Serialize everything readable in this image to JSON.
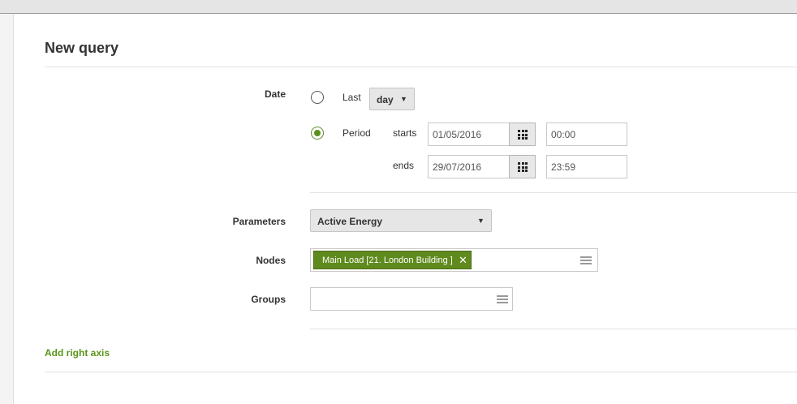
{
  "title": "New query",
  "date": {
    "label": "Date",
    "last_label": "Last",
    "last_unit": "day",
    "period_label": "Period",
    "selected": "period",
    "starts_label": "starts",
    "ends_label": "ends",
    "start_date": "01/05/2016",
    "start_time": "00:00",
    "end_date": "29/07/2016",
    "end_time": "23:59"
  },
  "parameters": {
    "label": "Parameters",
    "value": "Active Energy"
  },
  "nodes": {
    "label": "Nodes",
    "tags": [
      "Main Load [21. London Building ]"
    ]
  },
  "groups": {
    "label": "Groups",
    "tags": []
  },
  "add_right_axis": "Add right axis",
  "colors": {
    "accent": "#5f8a1e",
    "link": "#5a9418"
  },
  "icons": {
    "calendar": "calendar-grid-icon",
    "caret": "caret-down-icon",
    "remove": "close-icon",
    "list": "list-menu-icon"
  }
}
